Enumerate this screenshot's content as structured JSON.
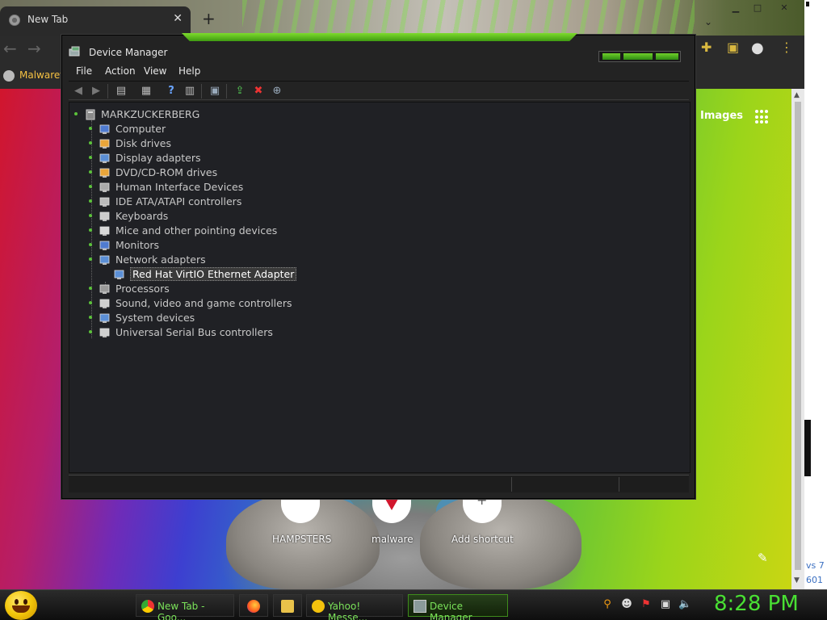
{
  "browser": {
    "tab_title": "New Tab",
    "bookmark_label": "Malwaret",
    "images_link": "Images",
    "shortcuts": [
      {
        "label": "HAMPSTERS"
      },
      {
        "label": "malware"
      },
      {
        "label": "Add shortcut"
      }
    ],
    "edge_text_1": "vs 7",
    "edge_text_2": "601"
  },
  "device_manager": {
    "title": "Device Manager",
    "menu": [
      "File",
      "Action",
      "View",
      "Help"
    ],
    "root": "MARKZUCKERBERG",
    "categories": [
      {
        "label": "Computer",
        "icon": "computer-icon"
      },
      {
        "label": "Disk drives",
        "icon": "disk-drive-icon"
      },
      {
        "label": "Display adapters",
        "icon": "display-adapter-icon"
      },
      {
        "label": "DVD/CD-ROM drives",
        "icon": "dvd-drive-icon"
      },
      {
        "label": "Human Interface Devices",
        "icon": "hid-icon"
      },
      {
        "label": "IDE ATA/ATAPI controllers",
        "icon": "ide-controller-icon"
      },
      {
        "label": "Keyboards",
        "icon": "keyboard-icon"
      },
      {
        "label": "Mice and other pointing devices",
        "icon": "mouse-icon"
      },
      {
        "label": "Monitors",
        "icon": "monitor-icon"
      },
      {
        "label": "Network adapters",
        "icon": "network-adapter-icon"
      },
      {
        "label": "Red Hat VirtIO Ethernet Adapter",
        "icon": "ethernet-adapter-icon",
        "selected": true
      },
      {
        "label": "Processors",
        "icon": "processor-icon"
      },
      {
        "label": "Sound, video and game controllers",
        "icon": "sound-icon"
      },
      {
        "label": "System devices",
        "icon": "system-devices-icon"
      },
      {
        "label": "Universal Serial Bus controllers",
        "icon": "usb-icon"
      }
    ]
  },
  "taskbar": {
    "tasks": [
      {
        "label": "New Tab - Goo...",
        "icon": "chrome-icon"
      },
      {
        "label": "",
        "icon": "firefox-icon"
      },
      {
        "label": "",
        "icon": "folder-icon"
      },
      {
        "label": "Yahoo! Messe...",
        "icon": "yahoo-messenger-icon"
      },
      {
        "label": "Device Manager",
        "icon": "device-manager-icon"
      }
    ],
    "clock": "8:28 PM"
  },
  "colors": {
    "accent_green": "#49e033",
    "window_bg": "#232323",
    "tree_text": "#c8c8c8"
  }
}
